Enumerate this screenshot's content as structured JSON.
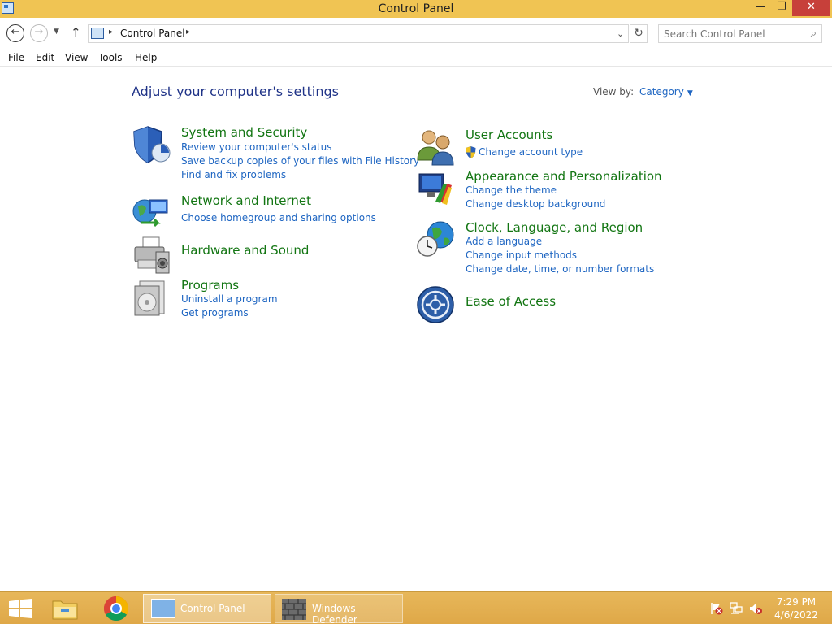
{
  "window": {
    "title": "Control Panel",
    "minimize_glyph": "—",
    "maximize_glyph": "❐",
    "close_glyph": "✕"
  },
  "address_bar": {
    "breadcrumb": "Control Panel",
    "search_placeholder": "Search Control Panel"
  },
  "menu": {
    "file": "File",
    "edit": "Edit",
    "view": "View",
    "tools": "Tools",
    "help": "Help"
  },
  "content": {
    "heading": "Adjust your computer's settings",
    "view_by_label": "View by:",
    "view_by_value": "Category",
    "categories": [
      {
        "title": "System and Security",
        "icon": "shield-icon",
        "links": [
          "Review your computer's status",
          "Save backup copies of your files with File History",
          "Find and fix problems"
        ]
      },
      {
        "title": "Network and Internet",
        "icon": "network-icon",
        "links": [
          "Choose homegroup and sharing options"
        ]
      },
      {
        "title": "Hardware and Sound",
        "icon": "printer-icon",
        "links": []
      },
      {
        "title": "Programs",
        "icon": "programs-icon",
        "links": [
          "Uninstall a program",
          "Get programs"
        ]
      },
      {
        "title": "User Accounts",
        "icon": "users-icon",
        "links": [
          "Change account type"
        ]
      },
      {
        "title": "Appearance and Personalization",
        "icon": "monitor-paint-icon",
        "links": [
          "Change the theme",
          "Change desktop background"
        ]
      },
      {
        "title": "Clock, Language, and Region",
        "icon": "globe-clock-icon",
        "links": [
          "Add a language",
          "Change input methods",
          "Change date, time, or number formats"
        ]
      },
      {
        "title": "Ease of Access",
        "icon": "ease-of-access-icon",
        "links": []
      }
    ]
  },
  "taskbar": {
    "apps": [
      {
        "label": "Control Panel",
        "icon": "control-panel-icon"
      },
      {
        "label": "Windows Defender",
        "icon": "defender-wall-icon"
      }
    ],
    "clock_time": "7:29 PM",
    "clock_date": "4/6/2022"
  },
  "colors": {
    "titlebar": "#f0c453",
    "taskbar": "#e2ad4e",
    "category_title": "#127512",
    "link": "#1f66c2",
    "heading": "#1e3287"
  }
}
